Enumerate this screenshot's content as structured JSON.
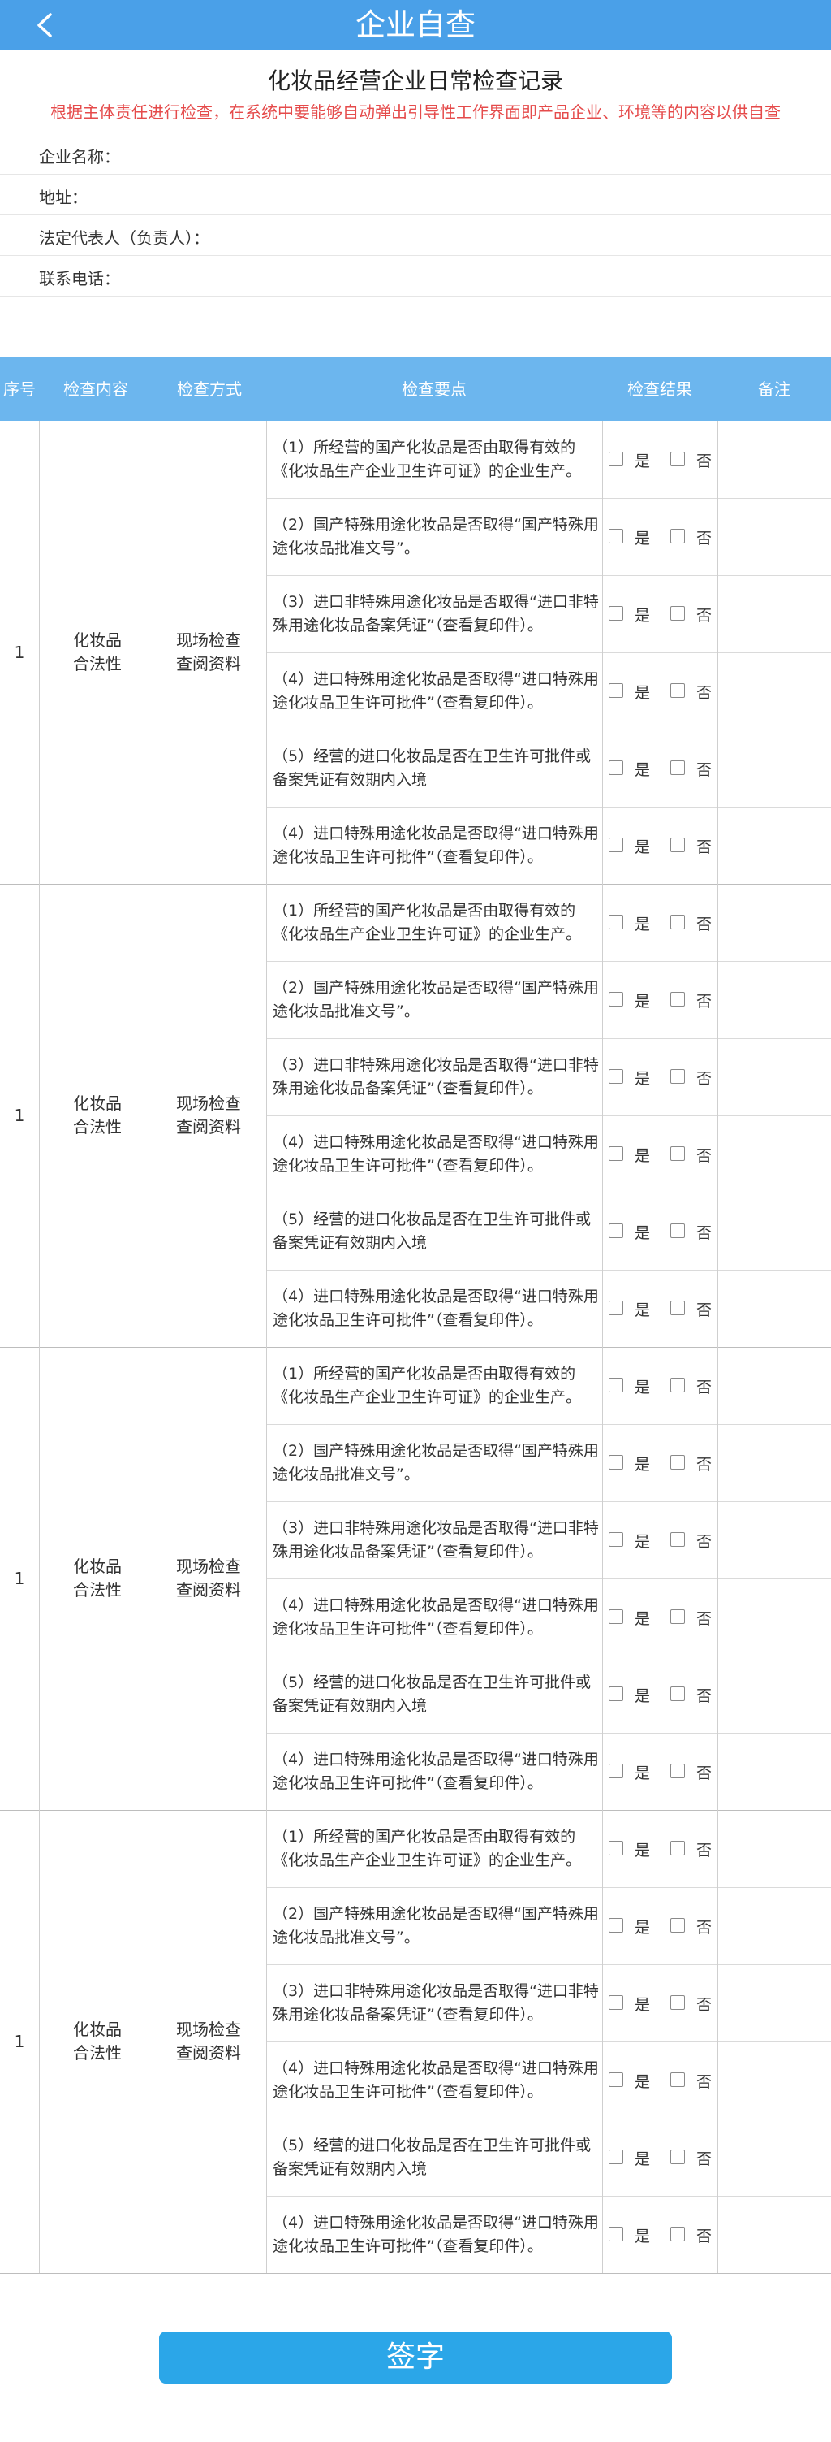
{
  "header": {
    "title": "企业自查",
    "back_icon": "chevron-left-icon"
  },
  "document": {
    "title": "化妆品经营企业日常检查记录",
    "notice": "根据主体责任进行检查，在系统中要能够自动弹出引导性工作界面即产品企业、环境等的内容以供自查"
  },
  "info_fields": [
    {
      "label": "企业名称："
    },
    {
      "label": "地址："
    },
    {
      "label": "法定代表人（负责人）："
    },
    {
      "label": "联系电话："
    }
  ],
  "table": {
    "headers": {
      "index": "序号",
      "content": "检查内容",
      "method": "检查方式",
      "points": "检查要点",
      "result": "检查结果",
      "note": "备注"
    },
    "yes_label": "是",
    "no_label": "否",
    "groups": [
      {
        "index": "1",
        "content": "化妆品合法性",
        "method": "现场检查查阅资料",
        "items": [
          "（1）所经营的国产化妆品是否由取得有效的《化妆品生产企业卫生许可证》的企业生产。",
          "（2）国产特殊用途化妆品是否取得“国产特殊用途化妆品批准文号”。",
          "（3）进口非特殊用途化妆品是否取得“进口非特殊用途化妆品备案凭证”（查看复印件）。",
          "（4）进口特殊用途化妆品是否取得“进口特殊用途化妆品卫生许可批件”（查看复印件）。",
          "（5）经营的进口化妆品是否在卫生许可批件或备案凭证有效期内入境",
          "（4）进口特殊用途化妆品是否取得“进口特殊用途化妆品卫生许可批件”（查看复印件）。"
        ]
      },
      {
        "index": "1",
        "content": "化妆品合法性",
        "method": "现场检查查阅资料",
        "items": [
          "（1）所经营的国产化妆品是否由取得有效的《化妆品生产企业卫生许可证》的企业生产。",
          "（2）国产特殊用途化妆品是否取得“国产特殊用途化妆品批准文号”。",
          "（3）进口非特殊用途化妆品是否取得“进口非特殊用途化妆品备案凭证”（查看复印件）。",
          "（4）进口特殊用途化妆品是否取得“进口特殊用途化妆品卫生许可批件”（查看复印件）。",
          "（5）经营的进口化妆品是否在卫生许可批件或备案凭证有效期内入境",
          "（4）进口特殊用途化妆品是否取得“进口特殊用途化妆品卫生许可批件”（查看复印件）。"
        ]
      },
      {
        "index": "1",
        "content": "化妆品合法性",
        "method": "现场检查查阅资料",
        "items": [
          "（1）所经营的国产化妆品是否由取得有效的《化妆品生产企业卫生许可证》的企业生产。",
          "（2）国产特殊用途化妆品是否取得“国产特殊用途化妆品批准文号”。",
          "（3）进口非特殊用途化妆品是否取得“进口非特殊用途化妆品备案凭证”（查看复印件）。",
          "（4）进口特殊用途化妆品是否取得“进口特殊用途化妆品卫生许可批件”（查看复印件）。",
          "（5）经营的进口化妆品是否在卫生许可批件或备案凭证有效期内入境",
          "（4）进口特殊用途化妆品是否取得“进口特殊用途化妆品卫生许可批件”（查看复印件）。"
        ]
      },
      {
        "index": "1",
        "content": "化妆品合法性",
        "method": "现场检查查阅资料",
        "items": [
          "（1）所经营的国产化妆品是否由取得有效的《化妆品生产企业卫生许可证》的企业生产。",
          "（2）国产特殊用途化妆品是否取得“国产特殊用途化妆品批准文号”。",
          "（3）进口非特殊用途化妆品是否取得“进口非特殊用途化妆品备案凭证”（查看复印件）。",
          "（4）进口特殊用途化妆品是否取得“进口特殊用途化妆品卫生许可批件”（查看复印件）。",
          "（5）经营的进口化妆品是否在卫生许可批件或备案凭证有效期内入境",
          "（4）进口特殊用途化妆品是否取得“进口特殊用途化妆品卫生许可批件”（查看复印件）。"
        ]
      }
    ]
  },
  "sign_button": {
    "label": "签字"
  }
}
